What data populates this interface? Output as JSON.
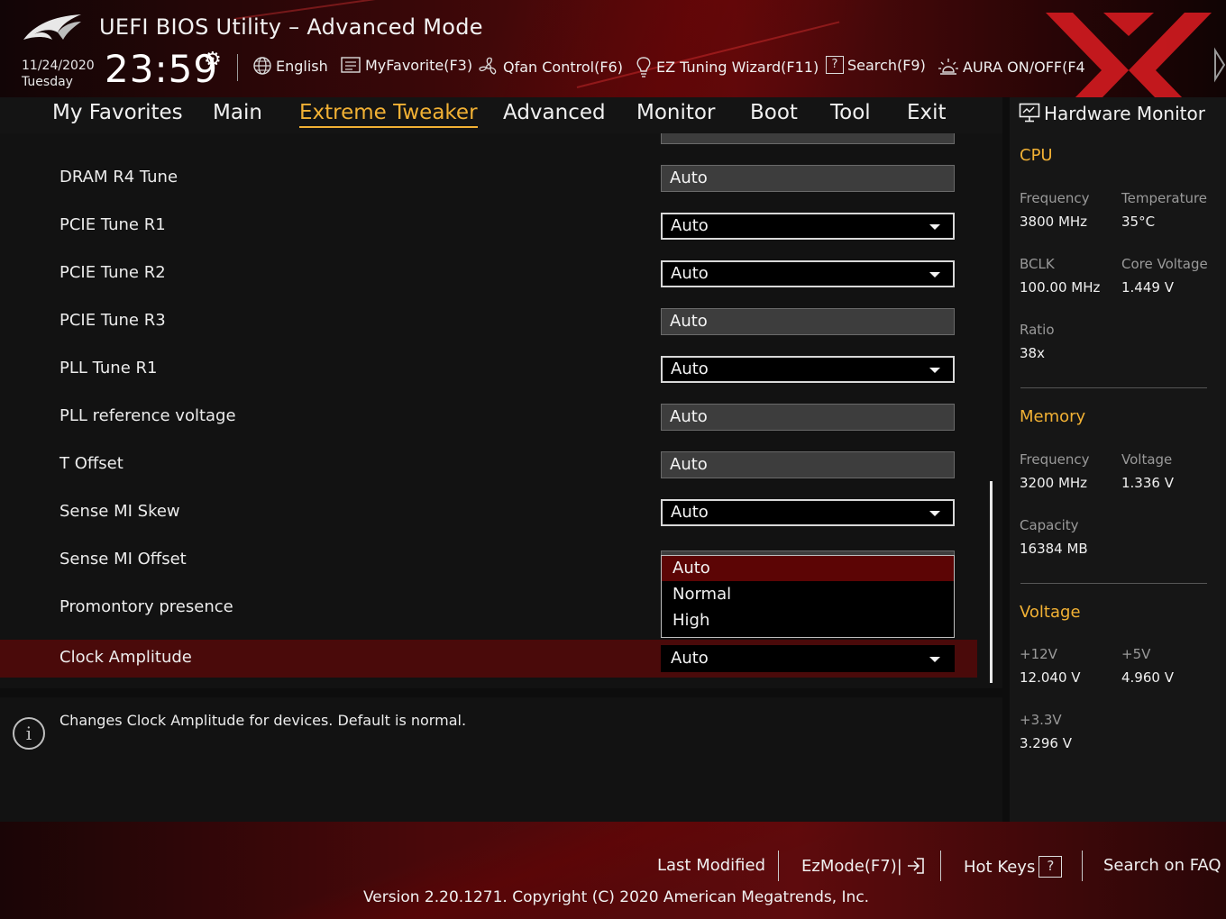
{
  "header": {
    "title": "UEFI BIOS Utility – Advanced Mode",
    "date": "11/24/2020",
    "weekday": "Tuesday",
    "time": "23:59",
    "toolbar": {
      "language": "English",
      "myfavorite": "MyFavorite(F3)",
      "qfan": "Qfan Control(F6)",
      "ez_tuning": "EZ Tuning Wizard(F11)",
      "search": "Search(F9)",
      "aura": "AURA ON/OFF(F4"
    }
  },
  "nav": {
    "tabs": [
      {
        "label": "My Favorites"
      },
      {
        "label": "Main"
      },
      {
        "label": "Extreme Tweaker"
      },
      {
        "label": "Advanced"
      },
      {
        "label": "Monitor"
      },
      {
        "label": "Boot"
      },
      {
        "label": "Tool"
      },
      {
        "label": "Exit"
      }
    ],
    "active": "Extreme Tweaker"
  },
  "settings": [
    {
      "label": "DRAM R4 Tune",
      "value": "Auto",
      "kind": "readonly"
    },
    {
      "label": "PCIE Tune R1",
      "value": "Auto",
      "kind": "dropdown"
    },
    {
      "label": "PCIE Tune R2",
      "value": "Auto",
      "kind": "dropdown"
    },
    {
      "label": "PCIE Tune R3",
      "value": "Auto",
      "kind": "readonly"
    },
    {
      "label": "PLL Tune R1",
      "value": "Auto",
      "kind": "dropdown"
    },
    {
      "label": "PLL reference voltage",
      "value": "Auto",
      "kind": "readonly"
    },
    {
      "label": "T Offset",
      "value": "Auto",
      "kind": "readonly"
    },
    {
      "label": "Sense MI Skew",
      "value": "Auto",
      "kind": "dropdown"
    },
    {
      "label": "Sense MI Offset",
      "value": "",
      "kind": "readonly"
    },
    {
      "label": "Promontory presence",
      "value": "",
      "kind": "none"
    },
    {
      "label": "Clock Amplitude",
      "value": "Auto",
      "kind": "dropdown"
    }
  ],
  "dropdown_popup": {
    "options": [
      "Auto",
      "Normal",
      "High"
    ],
    "highlighted": "Auto"
  },
  "help": {
    "text": "Changes Clock Amplitude for devices. Default is normal."
  },
  "hardware_monitor": {
    "title": "Hardware Monitor",
    "cpu": {
      "heading": "CPU",
      "frequency_label": "Frequency",
      "frequency": "3800 MHz",
      "temperature_label": "Temperature",
      "temperature": "35°C",
      "bclk_label": "BCLK",
      "bclk": "100.00 MHz",
      "core_voltage_label": "Core Voltage",
      "core_voltage": "1.449 V",
      "ratio_label": "Ratio",
      "ratio": "38x"
    },
    "memory": {
      "heading": "Memory",
      "frequency_label": "Frequency",
      "frequency": "3200 MHz",
      "voltage_label": "Voltage",
      "voltage": "1.336 V",
      "capacity_label": "Capacity",
      "capacity": "16384 MB"
    },
    "voltage": {
      "heading": "Voltage",
      "v12_label": "+12V",
      "v12": "12.040 V",
      "v5_label": "+5V",
      "v5": "4.960 V",
      "v33_label": "+3.3V",
      "v33": "3.296 V"
    }
  },
  "footer": {
    "last_modified": "Last Modified",
    "ezmode": "EzMode(F7)|",
    "hot_keys": "Hot Keys",
    "search_faq": "Search on FAQ",
    "version": "Version 2.20.1271. Copyright (C) 2020 American Megatrends, Inc."
  },
  "colors": {
    "accent": "#f2b134",
    "selected_row": "#4a0a0a",
    "popup_highlight": "#5c0505",
    "header_red": "#5b0a0c"
  }
}
